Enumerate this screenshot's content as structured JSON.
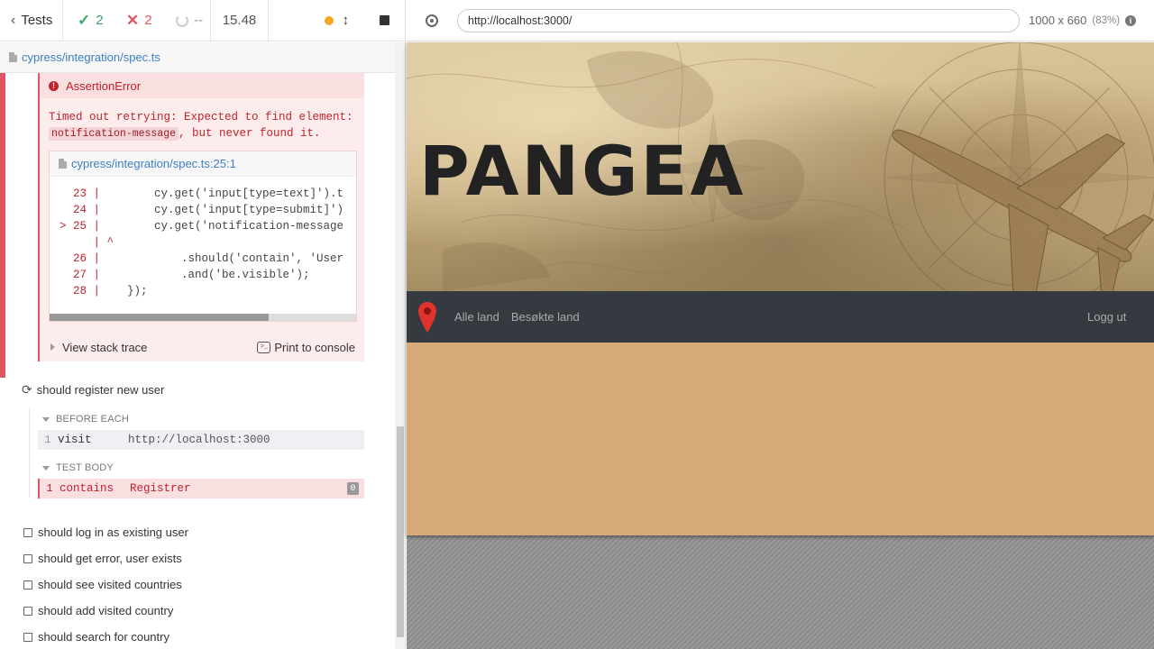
{
  "reporter": {
    "back_label": "Tests",
    "passed_count": "2",
    "failed_count": "2",
    "pending_count": "--",
    "duration": "15.48",
    "spec_path": "cypress/integration/spec.ts"
  },
  "error": {
    "title": "AssertionError",
    "message_before": "Timed out retrying: Expected to find element:",
    "selector": "notification-message",
    "message_after": ", but never found it.",
    "frame_location": "cypress/integration/spec.ts:25:1",
    "code_lines": [
      {
        "gutter": "23 |",
        "text": "        cy.get('input[type=text]').t"
      },
      {
        "gutter": "24 |",
        "text": "        cy.get('input[type=submit]')"
      },
      {
        "gutter": "> 25 |",
        "text": "        cy.get('notification-message"
      },
      {
        "gutter": "|",
        "text": " ^"
      },
      {
        "gutter": "26 |",
        "text": "            .should('contain', 'User"
      },
      {
        "gutter": "27 |",
        "text": "            .and('be.visible');"
      },
      {
        "gutter": "28 |",
        "text": "    });"
      }
    ],
    "view_stack_label": "View stack trace",
    "print_label": "Print to console"
  },
  "current_test": {
    "title": "should register new user",
    "before_each_label": "BEFORE EACH",
    "before_each_cmd": {
      "num": "1",
      "name": "visit",
      "msg": "http://localhost:3000"
    },
    "test_body_label": "TEST BODY",
    "body_cmd": {
      "num": "1",
      "name": "contains",
      "msg": "Registrer",
      "badge": "0"
    }
  },
  "tests": [
    "should log in as existing user",
    "should get error, user exists",
    "should see visited countries",
    "should add visited country",
    "should search for country"
  ],
  "aut": {
    "url": "http://localhost:3000/",
    "viewport": "1000 x 660",
    "scale": "(83%)"
  },
  "app": {
    "title": "PANGEA",
    "nav_links": [
      "Alle land",
      "Besøkte land"
    ],
    "logout": "Logg ut"
  },
  "colors": {
    "fail": "#e05561",
    "pass": "#39a86b",
    "navbar": "#343a40",
    "page_bg": "#d7aa77"
  }
}
